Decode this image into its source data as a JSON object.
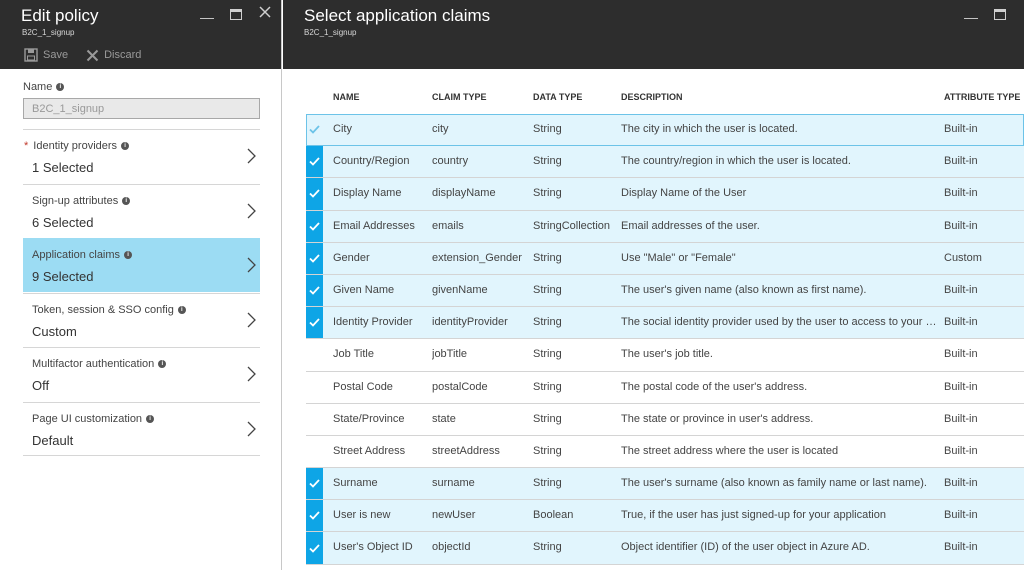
{
  "left": {
    "title": "Edit policy",
    "subtitle": "B2C_1_signup",
    "toolbar": {
      "save": "Save",
      "discard": "Discard"
    },
    "name_label": "Name",
    "name_value": "B2C_1_signup",
    "items": [
      {
        "label": "Identity providers",
        "value": "1 Selected",
        "required": "*"
      },
      {
        "label": "Sign-up attributes",
        "value": "6 Selected"
      },
      {
        "label": "Application claims",
        "value": "9 Selected"
      },
      {
        "label": "Token, session & SSO config",
        "value": "Custom"
      },
      {
        "label": "Multifactor authentication",
        "value": "Off"
      },
      {
        "label": "Page UI customization",
        "value": "Default"
      }
    ]
  },
  "right": {
    "title": "Select application claims",
    "subtitle": "B2C_1_signup",
    "columns": {
      "name": "NAME",
      "claim_type": "CLAIM TYPE",
      "data_type": "DATA TYPE",
      "description": "DESCRIPTION",
      "attribute_type": "ATTRIBUTE TYPE"
    },
    "rows": [
      {
        "selected": true,
        "name": "City",
        "claim": "city",
        "data": "String",
        "desc": "The city in which the user is located.",
        "attr": "Built-in"
      },
      {
        "selected": true,
        "name": "Country/Region",
        "claim": "country",
        "data": "String",
        "desc": "The country/region in which the user is located.",
        "attr": "Built-in"
      },
      {
        "selected": true,
        "name": "Display Name",
        "claim": "displayName",
        "data": "String",
        "desc": "Display Name of the User",
        "attr": "Built-in"
      },
      {
        "selected": true,
        "name": "Email Addresses",
        "claim": "emails",
        "data": "StringCollection",
        "desc": "Email addresses of the user.",
        "attr": "Built-in"
      },
      {
        "selected": true,
        "name": "Gender",
        "claim": "extension_Gender",
        "data": "String",
        "desc": "Use \"Male\" or \"Female\"",
        "attr": "Custom"
      },
      {
        "selected": true,
        "name": "Given Name",
        "claim": "givenName",
        "data": "String",
        "desc": "The user's given name (also known as first name).",
        "attr": "Built-in"
      },
      {
        "selected": true,
        "name": "Identity Provider",
        "claim": "identityProvider",
        "data": "String",
        "desc": "The social identity provider used by the user to access to your ap...",
        "attr": "Built-in"
      },
      {
        "selected": false,
        "name": "Job Title",
        "claim": "jobTitle",
        "data": "String",
        "desc": "The user's job title.",
        "attr": "Built-in"
      },
      {
        "selected": false,
        "name": "Postal Code",
        "claim": "postalCode",
        "data": "String",
        "desc": "The postal code of the user's address.",
        "attr": "Built-in"
      },
      {
        "selected": false,
        "name": "State/Province",
        "claim": "state",
        "data": "String",
        "desc": "The state or province in user's address.",
        "attr": "Built-in"
      },
      {
        "selected": false,
        "name": "Street Address",
        "claim": "streetAddress",
        "data": "String",
        "desc": "The street address where the user is located",
        "attr": "Built-in"
      },
      {
        "selected": true,
        "name": "Surname",
        "claim": "surname",
        "data": "String",
        "desc": "The user's surname (also known as family name or last name).",
        "attr": "Built-in"
      },
      {
        "selected": true,
        "name": "User is new",
        "claim": "newUser",
        "data": "Boolean",
        "desc": "True, if the user has just signed-up for your application",
        "attr": "Built-in"
      },
      {
        "selected": true,
        "name": "User's Object ID",
        "claim": "objectId",
        "data": "String",
        "desc": "Object identifier (ID) of the user object in Azure AD.",
        "attr": "Built-in"
      }
    ]
  },
  "colors": {
    "accent": "#0ea5e6",
    "selected_row": "#e1f5fd",
    "active_nav": "#9cdcf3",
    "header_bg": "#2d2d2d"
  }
}
